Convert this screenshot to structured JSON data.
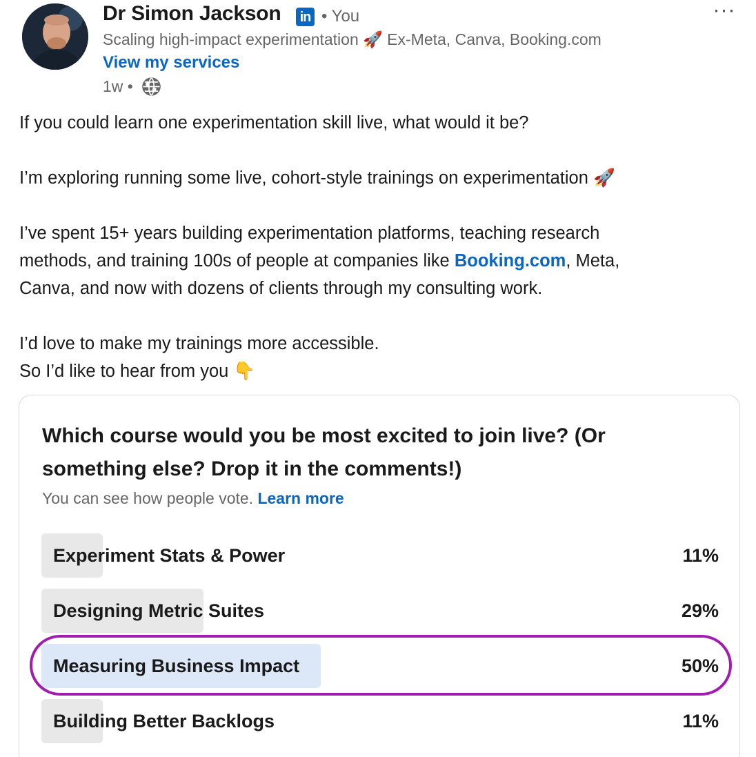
{
  "author": {
    "name": "Dr Simon Jackson",
    "badge_icon": "linkedin-icon",
    "badge_text": "in",
    "relation": "• You",
    "headline": "Scaling high-impact experimentation 🚀 Ex-Meta, Canva, Booking.com",
    "services_link": "View my services",
    "timestamp": "1w •",
    "visibility_icon": "globe-icon"
  },
  "menu": {
    "more_label": "···"
  },
  "post": {
    "line1": "If you could learn one experimentation skill live, what would it be?",
    "line2": "I’m exploring running some live, cohort-style trainings on experimentation 🚀",
    "line3": "I’ve spent 15+ years building experimentation platforms, teaching research",
    "line4_before": "methods, and training 100s of people at companies like ",
    "line4_link": "Booking.com",
    "line4_after": ", Meta,",
    "line5": "Canva, and now with dozens of clients through my consulting work.",
    "line6": "I’d love to make my trainings more accessible.",
    "line7": "So I’d like to hear from you 👇"
  },
  "poll": {
    "question": "Which course would you be most excited to join live? (Or something else? Drop it in the comments!)",
    "note": "You can see how people vote.",
    "learn_more": "Learn more",
    "options": [
      {
        "label": "Experiment Stats & Power",
        "percent_text": "11%",
        "percent": 11,
        "selected": false
      },
      {
        "label": "Designing Metric Suites",
        "percent_text": "29%",
        "percent": 29,
        "selected": false
      },
      {
        "label": "Measuring Business Impact",
        "percent_text": "50%",
        "percent": 50,
        "selected": true
      },
      {
        "label": "Building Better Backlogs",
        "percent_text": "11%",
        "percent": 11,
        "selected": false
      }
    ]
  },
  "colors": {
    "link": "#0a66c2",
    "bar_default": "#e8e8e8",
    "bar_selected": "#dce8f8",
    "highlight_ring": "#a21caf"
  }
}
